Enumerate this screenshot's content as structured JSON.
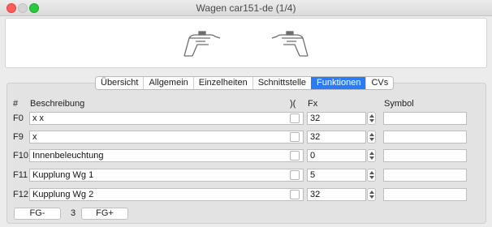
{
  "window": {
    "title": "Wagen car151-de (1/4)"
  },
  "tabs": [
    {
      "label": "Übersicht",
      "active": false
    },
    {
      "label": "Allgemein",
      "active": false
    },
    {
      "label": "Einzelheiten",
      "active": false
    },
    {
      "label": "Schnittstelle",
      "active": false
    },
    {
      "label": "Funktionen",
      "active": true
    },
    {
      "label": "CVs",
      "active": false
    }
  ],
  "table": {
    "headers": {
      "num": "#",
      "desc": "Beschreibung",
      "toggle": ")(",
      "fx": "Fx",
      "symbol": "Symbol"
    },
    "rows": [
      {
        "label": "F0",
        "desc": "x x",
        "fx": "32",
        "symbol": ""
      },
      {
        "label": "F9",
        "desc": "x",
        "fx": "32",
        "symbol": ""
      },
      {
        "label": "F10",
        "desc": "Innenbeleuchtung",
        "fx": "0",
        "symbol": ""
      },
      {
        "label": "F11",
        "desc": "Kupplung Wg 1",
        "fx": "5",
        "symbol": ""
      },
      {
        "label": "F12",
        "desc": "Kupplung Wg 2",
        "fx": "32",
        "symbol": ""
      }
    ]
  },
  "footer": {
    "fg_minus": "FG-",
    "group_number": "3",
    "fg_plus": "FG+"
  },
  "colors": {
    "accent": "#2c7bf6"
  }
}
